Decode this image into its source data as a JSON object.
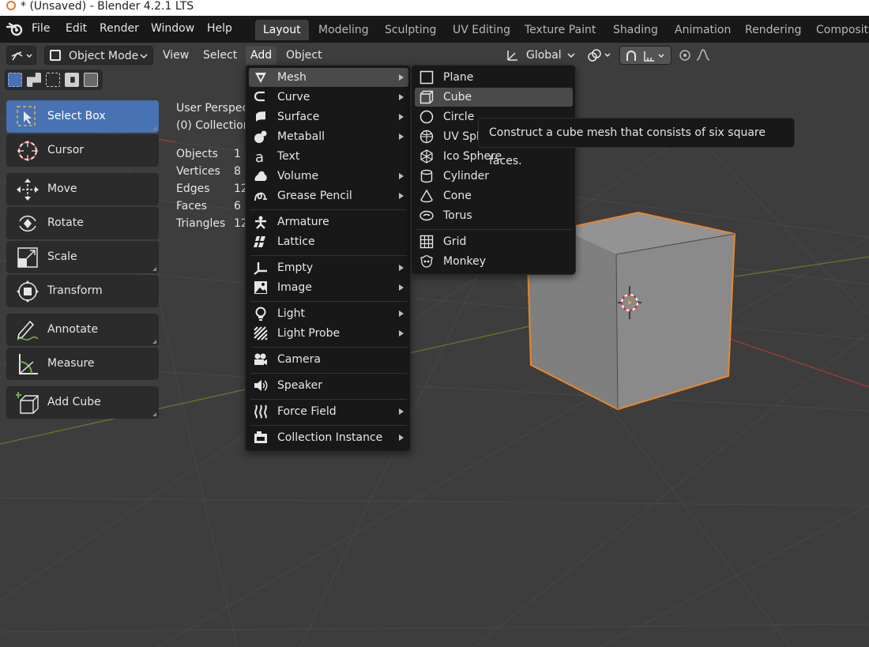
{
  "window": {
    "title": "* (Unsaved) - Blender 4.2.1 LTS"
  },
  "menubar": {
    "items": [
      "File",
      "Edit",
      "Render",
      "Window",
      "Help"
    ],
    "workspaces": [
      "Layout",
      "Modeling",
      "Sculpting",
      "UV Editing",
      "Texture Paint",
      "Shading",
      "Animation",
      "Rendering",
      "Compositin"
    ],
    "active_workspace": "Layout"
  },
  "header": {
    "mode": "Object Mode",
    "menus": [
      "View",
      "Select",
      "Add",
      "Object"
    ],
    "transform_orientation": "Global"
  },
  "toolbar": {
    "items": [
      {
        "label": "Select Box",
        "icon": "select-box-icon",
        "active": true
      },
      {
        "label": "Cursor",
        "icon": "cursor-icon"
      },
      {
        "label": "Move",
        "icon": "move-icon"
      },
      {
        "label": "Rotate",
        "icon": "rotate-icon"
      },
      {
        "label": "Scale",
        "icon": "scale-icon"
      },
      {
        "label": "Transform",
        "icon": "transform-icon"
      },
      {
        "label": "Annotate",
        "icon": "annotate-icon"
      },
      {
        "label": "Measure",
        "icon": "measure-icon"
      },
      {
        "label": "Add Cube",
        "icon": "add-cube-icon"
      }
    ]
  },
  "viewport": {
    "view_name": "User Perspec",
    "collection": "(0) Collection",
    "stats": [
      {
        "label": "Objects",
        "value": "1"
      },
      {
        "label": "Vertices",
        "value": "8"
      },
      {
        "label": "Edges",
        "value": "12"
      },
      {
        "label": "Faces",
        "value": "6"
      },
      {
        "label": "Triangles",
        "value": "12"
      }
    ],
    "colors": {
      "background": "#3d3d3d",
      "grid": "#4a4a4a",
      "x_axis": "#a13a3a",
      "y_axis": "#5e7d2a",
      "selection": "#e8872b"
    }
  },
  "add_menu": {
    "items": [
      {
        "label": "Mesh",
        "icon": "mesh-icon",
        "submenu": true,
        "highlighted": true
      },
      {
        "label": "Curve",
        "icon": "curve-icon",
        "submenu": true
      },
      {
        "label": "Surface",
        "icon": "surface-icon",
        "submenu": true
      },
      {
        "label": "Metaball",
        "icon": "metaball-icon",
        "submenu": true
      },
      {
        "label": "Text",
        "icon": "text-icon",
        "submenu": false
      },
      {
        "label": "Volume",
        "icon": "volume-icon",
        "submenu": true
      },
      {
        "label": "Grease Pencil",
        "icon": "grease-pencil-icon",
        "submenu": true
      },
      {
        "label": "Armature",
        "icon": "armature-icon",
        "submenu": false
      },
      {
        "label": "Lattice",
        "icon": "lattice-icon",
        "submenu": false
      },
      {
        "label": "Empty",
        "icon": "empty-icon",
        "submenu": true
      },
      {
        "label": "Image",
        "icon": "image-icon",
        "submenu": true
      },
      {
        "label": "Light",
        "icon": "light-icon",
        "submenu": true
      },
      {
        "label": "Light Probe",
        "icon": "light-probe-icon",
        "submenu": true
      },
      {
        "label": "Camera",
        "icon": "camera-icon",
        "submenu": false
      },
      {
        "label": "Speaker",
        "icon": "speaker-icon",
        "submenu": false
      },
      {
        "label": "Force Field",
        "icon": "force-field-icon",
        "submenu": true
      },
      {
        "label": "Collection Instance",
        "icon": "collection-instance-icon",
        "submenu": true
      }
    ]
  },
  "mesh_menu": {
    "items": [
      {
        "label": "Plane",
        "icon": "plane-icon"
      },
      {
        "label": "Cube",
        "icon": "cube-icon",
        "highlighted": true
      },
      {
        "label": "Circle",
        "icon": "circle-icon"
      },
      {
        "label": "UV Sphere",
        "icon": "uv-sphere-icon"
      },
      {
        "label": "Ico Sphere",
        "icon": "ico-sphere-icon"
      },
      {
        "label": "Cylinder",
        "icon": "cylinder-icon"
      },
      {
        "label": "Cone",
        "icon": "cone-icon"
      },
      {
        "label": "Torus",
        "icon": "torus-icon"
      },
      {
        "label": "Grid",
        "icon": "grid-icon"
      },
      {
        "label": "Monkey",
        "icon": "monkey-icon"
      }
    ]
  },
  "tooltip": {
    "text": "Construct a cube mesh that consists of six square faces."
  }
}
